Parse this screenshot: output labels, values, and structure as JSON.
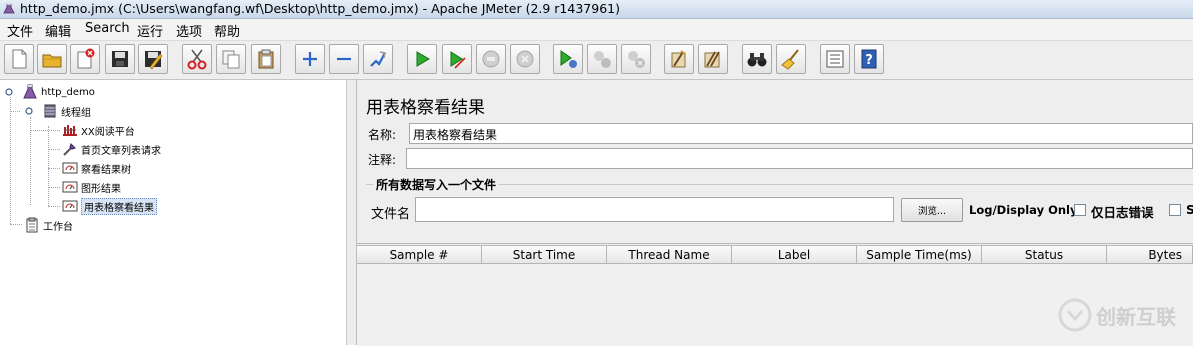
{
  "window": {
    "title": "http_demo.jmx (C:\\Users\\wangfang.wf\\Desktop\\http_demo.jmx) - Apache JMeter (2.9 r1437961)"
  },
  "menu": [
    "文件",
    "编辑",
    "Search",
    "运行",
    "选项",
    "帮助"
  ],
  "toolbar": [
    {
      "name": "new-icon"
    },
    {
      "name": "open-icon"
    },
    {
      "name": "close-file-icon"
    },
    {
      "name": "save-icon"
    },
    {
      "name": "save-as-icon"
    },
    {
      "name": "cut-icon"
    },
    {
      "name": "copy-icon"
    },
    {
      "name": "paste-icon"
    },
    {
      "name": "expand-icon"
    },
    {
      "name": "collapse-icon"
    },
    {
      "name": "toggle-icon"
    },
    {
      "name": "start-icon"
    },
    {
      "name": "start-no-pause-icon"
    },
    {
      "name": "stop-icon"
    },
    {
      "name": "shutdown-icon"
    },
    {
      "name": "remote-start-icon"
    },
    {
      "name": "remote-stop-icon"
    },
    {
      "name": "remote-shutdown-icon"
    },
    {
      "name": "clear-icon"
    },
    {
      "name": "clear-all-icon"
    },
    {
      "name": "search-icon"
    },
    {
      "name": "reset-search-icon"
    },
    {
      "name": "function-helper-icon"
    },
    {
      "name": "help-icon"
    }
  ],
  "tree": {
    "root": "http_demo",
    "thread_group": "线程组",
    "children": [
      "XX阅读平台",
      "首页文章列表请求",
      "察看结果树",
      "图形结果",
      "用表格察看结果"
    ],
    "workbench": "工作台"
  },
  "panel": {
    "title": "用表格察看结果",
    "name_label": "名称:",
    "name_value": "用表格察看结果",
    "comment_label": "注释:",
    "comment_value": "",
    "group_title": "所有数据写入一个文件",
    "filename_label": "文件名",
    "filename_value": "",
    "browse_label": "浏览...",
    "log_display_label": "Log/Display Only:",
    "errors_label": "仅日志错误",
    "successes_label": "S"
  },
  "table": {
    "columns": [
      "Sample #",
      "Start Time",
      "Thread Name",
      "Label",
      "Sample Time(ms)",
      "Status",
      "Bytes"
    ]
  },
  "watermark": {
    "text": "创新互联"
  }
}
